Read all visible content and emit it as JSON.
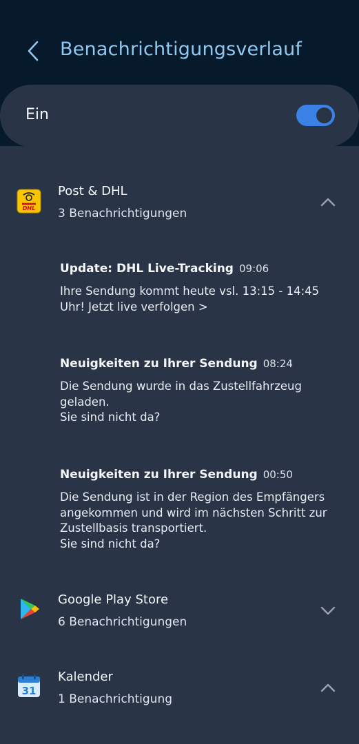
{
  "header": {
    "title": "Benachrichtigungsverlauf"
  },
  "toggle": {
    "label": "Ein",
    "state": "on",
    "accent": "#3b82e6"
  },
  "apps": [
    {
      "name": "Post & DHL",
      "count": "3 Benachrichtigungen",
      "icon": "dhl-icon",
      "expanded": true,
      "notifications": [
        {
          "title": "Update: DHL Live-Tracking",
          "time": "09:06",
          "body": "Ihre Sendung kommt heute vsl. 13:15 - 14:45\nUhr! Jetzt live verfolgen >"
        },
        {
          "title": "Neuigkeiten zu Ihrer Sendung",
          "time": "08:24",
          "body": "Die Sendung wurde in das Zustellfahrzeug\ngeladen.\nSie sind nicht da?"
        },
        {
          "title": "Neuigkeiten zu Ihrer Sendung",
          "time": "00:50",
          "body": "Die Sendung ist in der Region des Empfängers\nangekommen und wird im nächsten Schritt zur\nZustellbasis transportiert.\nSie sind nicht da?"
        }
      ]
    },
    {
      "name": "Google Play Store",
      "count": "6 Benachrichtigungen",
      "icon": "play-store-icon",
      "expanded": false
    },
    {
      "name": "Kalender",
      "count": "1 Benachrichtigung",
      "icon": "calendar-icon",
      "icon_text": "31",
      "expanded": true
    }
  ]
}
